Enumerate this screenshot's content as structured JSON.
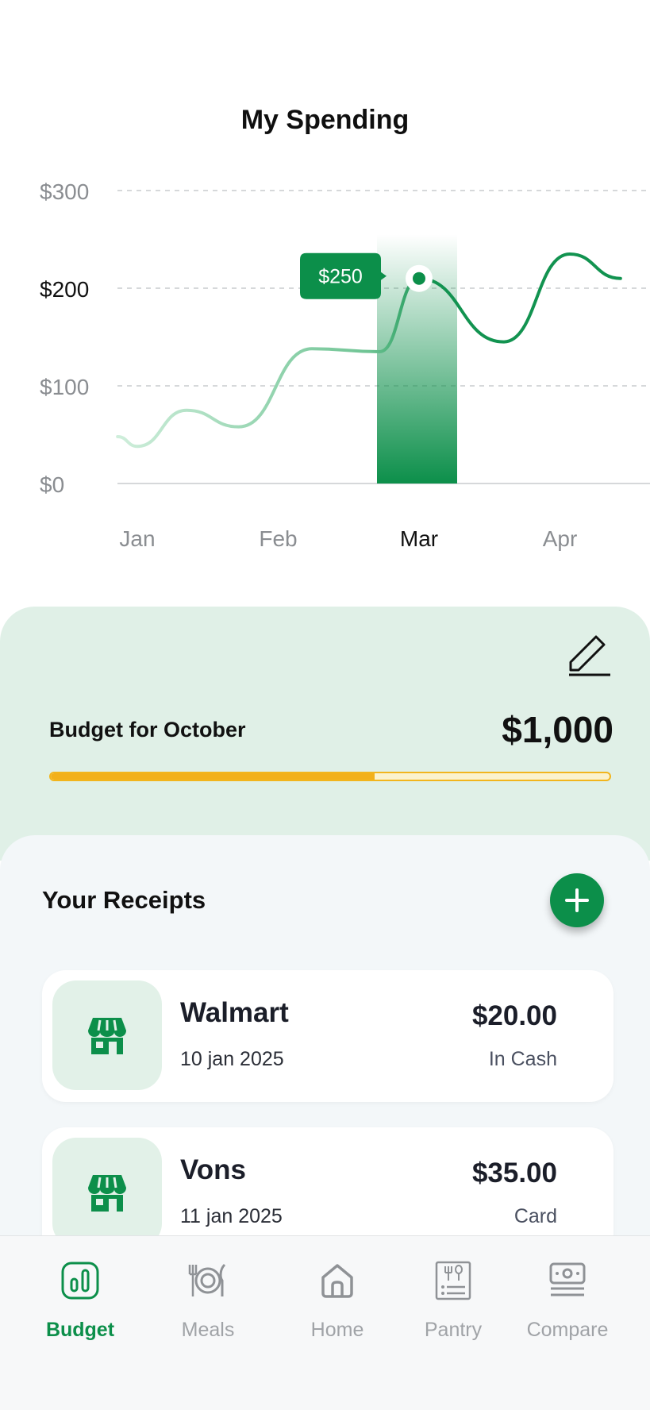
{
  "header": {
    "title": "My Spending"
  },
  "chart_data": {
    "type": "line",
    "title": "My Spending",
    "x": [
      "Jan",
      "Feb",
      "Mar",
      "Apr"
    ],
    "y_ticks": [
      "$0",
      "$100",
      "$200",
      "$300"
    ],
    "ylim": [
      0,
      300
    ],
    "series": [
      {
        "x": [
          -0.14,
          0.0,
          0.35,
          0.72,
          1.24,
          1.72,
          2.0,
          2.6,
          3.07,
          3.43
        ],
        "y": [
          48,
          38,
          75,
          58,
          138,
          135,
          210,
          145,
          235,
          210
        ]
      }
    ],
    "selected": {
      "category": "Mar",
      "label": "$250"
    },
    "grid": true,
    "colors": {
      "line": "#129350",
      "line_faded": "#b8e2c8",
      "highlight": "#0c8f4a"
    }
  },
  "budget": {
    "label": "Budget for October",
    "amount": "$1,000",
    "progress": 0.58,
    "edit_icon": "pencil-icon"
  },
  "receipts": {
    "title": "Your Receipts",
    "add_icon": "plus-icon",
    "items": [
      {
        "name": "Walmart",
        "date": "10 jan 2025",
        "amount": "$20.00",
        "method": "In Cash",
        "icon": "store-icon"
      },
      {
        "name": "Vons",
        "date": "11 jan 2025",
        "amount": "$35.00",
        "method": "Card",
        "icon": "store-icon"
      }
    ]
  },
  "nav": {
    "items": [
      {
        "label": "Budget",
        "icon": "chart-icon",
        "active": true
      },
      {
        "label": "Meals",
        "icon": "meals-icon",
        "active": false
      },
      {
        "label": "Home",
        "icon": "home-icon",
        "active": false
      },
      {
        "label": "Pantry",
        "icon": "pantry-icon",
        "active": false
      },
      {
        "label": "Compare",
        "icon": "compare-icon",
        "active": false
      }
    ]
  },
  "colors": {
    "accent": "#0c8f4a",
    "progress": "#f2b01a",
    "budget_bg": "#e0f0e7"
  }
}
